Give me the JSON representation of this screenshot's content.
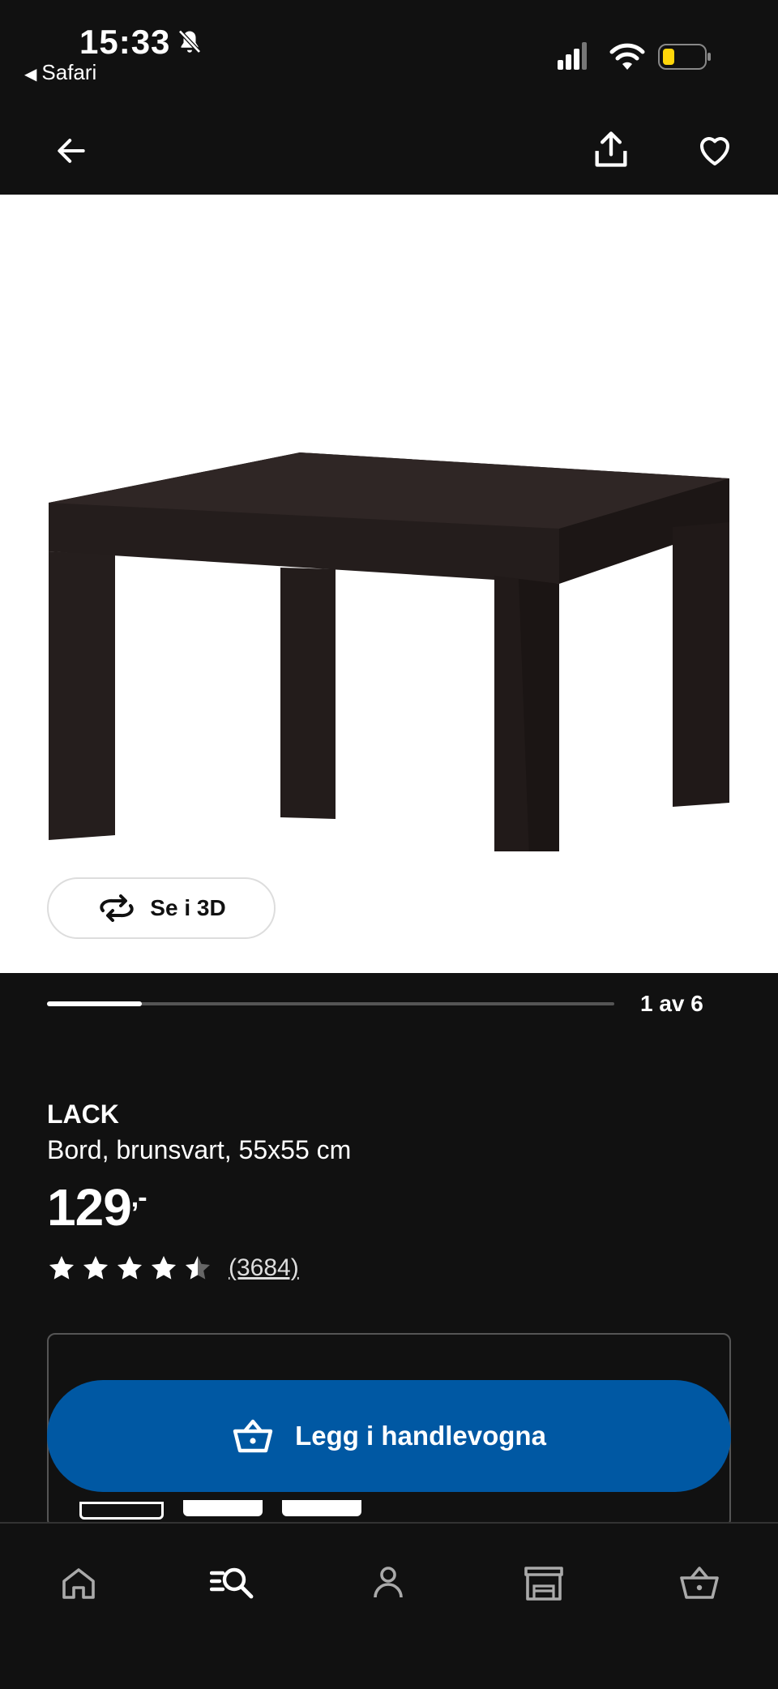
{
  "status_bar": {
    "time": "15:33",
    "back_app": "Safari"
  },
  "top_nav": {
    "icons": [
      "back-arrow-icon",
      "share-icon",
      "heart-icon"
    ]
  },
  "gallery": {
    "view_3d_label": "Se i 3D",
    "counter": "1 av 6",
    "progress": 0.167
  },
  "product": {
    "name": "LACK",
    "description": "Bord, brunsvart, 55x55 cm",
    "price": "129",
    "price_suffix": ",-",
    "rating": 4.5,
    "review_count": "(3684)"
  },
  "cart": {
    "button_label": "Legg i handlevogna"
  },
  "bottom_nav": {
    "items": [
      "home-icon",
      "search-icon",
      "profile-icon",
      "store-icon",
      "cart-icon"
    ]
  },
  "colors": {
    "background": "#111111",
    "accent_blue": "#0058a3",
    "white": "#ffffff"
  }
}
